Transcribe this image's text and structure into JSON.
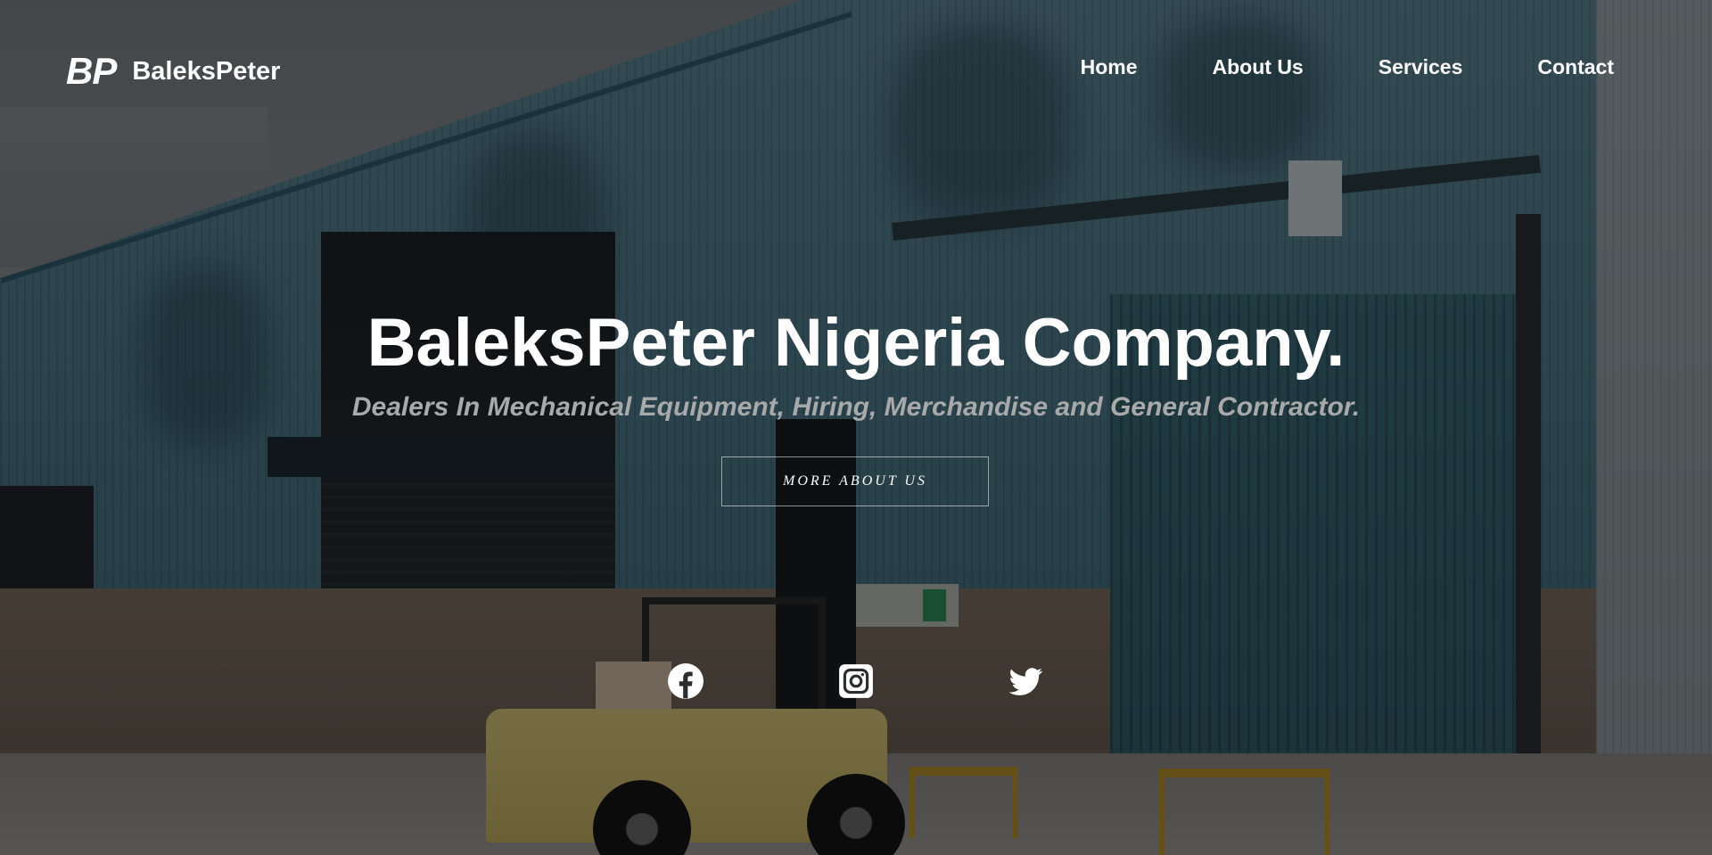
{
  "brand": {
    "mark": "BP",
    "name": "BaleksPeter"
  },
  "nav": {
    "items": [
      {
        "label": "Home"
      },
      {
        "label": "About Us"
      },
      {
        "label": "Services"
      },
      {
        "label": "Contact"
      }
    ]
  },
  "hero": {
    "title": "BaleksPeter Nigeria Company.",
    "subtitle": "Dealers In Mechanical Equipment, Hiring, Merchandise and General Contractor.",
    "cta_label": "MORE ABOUT US"
  },
  "social": [
    {
      "icon": "facebook-icon"
    },
    {
      "icon": "instagram-icon"
    },
    {
      "icon": "twitter-icon"
    }
  ],
  "colors": {
    "text": "#ffffff",
    "subtitle": "#a7a9ab",
    "overlay": "rgba(0,0,0,0.45)"
  }
}
